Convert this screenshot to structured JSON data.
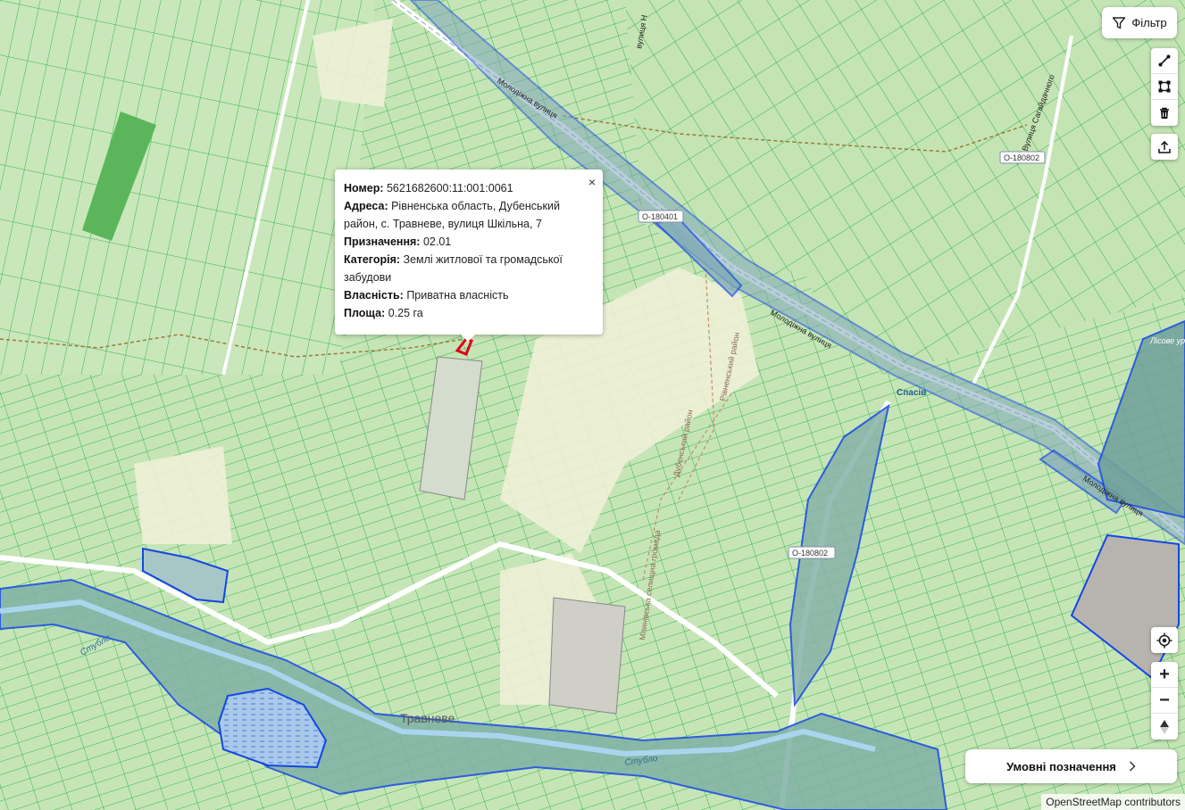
{
  "filter": {
    "label": "Фільтр",
    "icon": "funnel-icon"
  },
  "draw_tools": {
    "icons": [
      "draw-line-icon",
      "draw-polygon-icon",
      "trash-icon"
    ]
  },
  "export_tool": {
    "icon": "upload-icon"
  },
  "zoom": {
    "locate_icon": "crosshair-icon",
    "plus": "+",
    "minus": "−",
    "compass_icon": "north-arrow-icon"
  },
  "popup": {
    "close": "×",
    "number_label": "Номер:",
    "number": "5621682600:11:001:0061",
    "address_label": "Адреса:",
    "address": "Рівненська область, Дубенський район, с. Травневе, вулиця Шкільна, 7",
    "purpose_label": "Призначення:",
    "purpose": "02.01",
    "category_label": "Категорія:",
    "category": "Землі житлової та громадської забудови",
    "ownership_label": "Власність:",
    "ownership": "Приватна власність",
    "area_label": "Площа:",
    "area": "0.25 га"
  },
  "legend": {
    "label": "Умовні позначення",
    "icon": "chevron-right-icon"
  },
  "attribution": "OpenStreetMap contributors",
  "map_labels": {
    "village": "Травневе",
    "river_1": "Стубло",
    "river_2": "Стубло",
    "street_1": "Молодіжна вулиця",
    "street_2": "Молодіжна вулиця",
    "street_3": "Молодіжна вулиця",
    "street_4": "Вулиця Сагайдачного",
    "street_5": "вулиця Н",
    "road_1": "О-180401",
    "road_2": "О-180802",
    "road_3": "О-180802",
    "district_1": "Рівненський район",
    "district_2": "Дубенський район",
    "community": "Млинівська селищна громада",
    "place": "Спасів",
    "forest": "Лісове урочище Ділянка букового лісу"
  },
  "colors": {
    "parcel_fill": "#c3e4b3",
    "parcel_stroke": "#2fb34a",
    "boundary": "#1446e6",
    "selected": "#e0001a",
    "water": "#a9c8ea"
  }
}
